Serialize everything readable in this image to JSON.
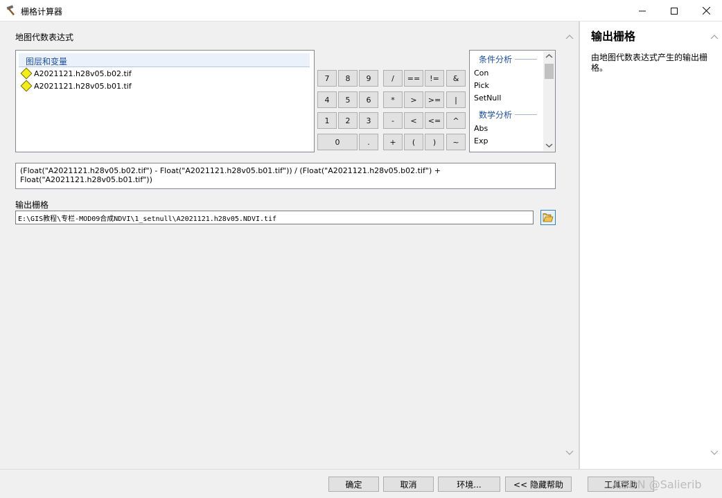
{
  "window": {
    "title": "栅格计算器",
    "minimize": "—",
    "maximize": "☐",
    "close": "✕"
  },
  "main": {
    "expression_section_label": "地图代数表达式",
    "layers": {
      "header": "图层和变量",
      "items": [
        "A2021121.h28v05.b02.tif",
        "A2021121.h28v05.b01.tif"
      ]
    },
    "calculator": {
      "rows": [
        [
          "7",
          "8",
          "9"
        ],
        [
          "4",
          "5",
          "6"
        ],
        [
          "1",
          "2",
          "3"
        ]
      ],
      "zero": "0",
      "dot": ".",
      "ops": [
        [
          "/",
          "==",
          "!=",
          "&"
        ],
        [
          "*",
          ">",
          ">=",
          "|"
        ],
        [
          "-",
          "<",
          "<=",
          "^"
        ],
        [
          "+",
          "(",
          ")",
          "~"
        ]
      ]
    },
    "functions": {
      "group1": "条件分析",
      "group1_items": [
        "Con",
        "Pick",
        "SetNull"
      ],
      "group2": "数学分析",
      "group2_items": [
        "Abs",
        "Exp"
      ]
    },
    "expression": "(Float(\"A2021121.h28v05.b02.tif\") - Float(\"A2021121.h28v05.b01.tif\")) / (Float(\"A2021121.h28v05.b02.tif\") + Float(\"A2021121.h28v05.b01.tif\"))",
    "output_label": "输出栅格",
    "output_path": "E:\\GIS教程\\专栏-MOD09合成NDVI\\1_setnull\\A2021121.h28v05.NDVI.tif"
  },
  "help": {
    "title": "输出栅格",
    "description": "由地图代数表达式产生的输出栅格。"
  },
  "footer": {
    "ok": "确定",
    "cancel": "取消",
    "environments": "环境...",
    "hide_help": "<< 隐藏帮助",
    "tool_help": "工具帮助",
    "watermark": "CSDN @Salierib"
  },
  "icons": {
    "app": "hammer-icon",
    "folder": "open-folder-icon",
    "layer": "raster-layer-icon"
  }
}
